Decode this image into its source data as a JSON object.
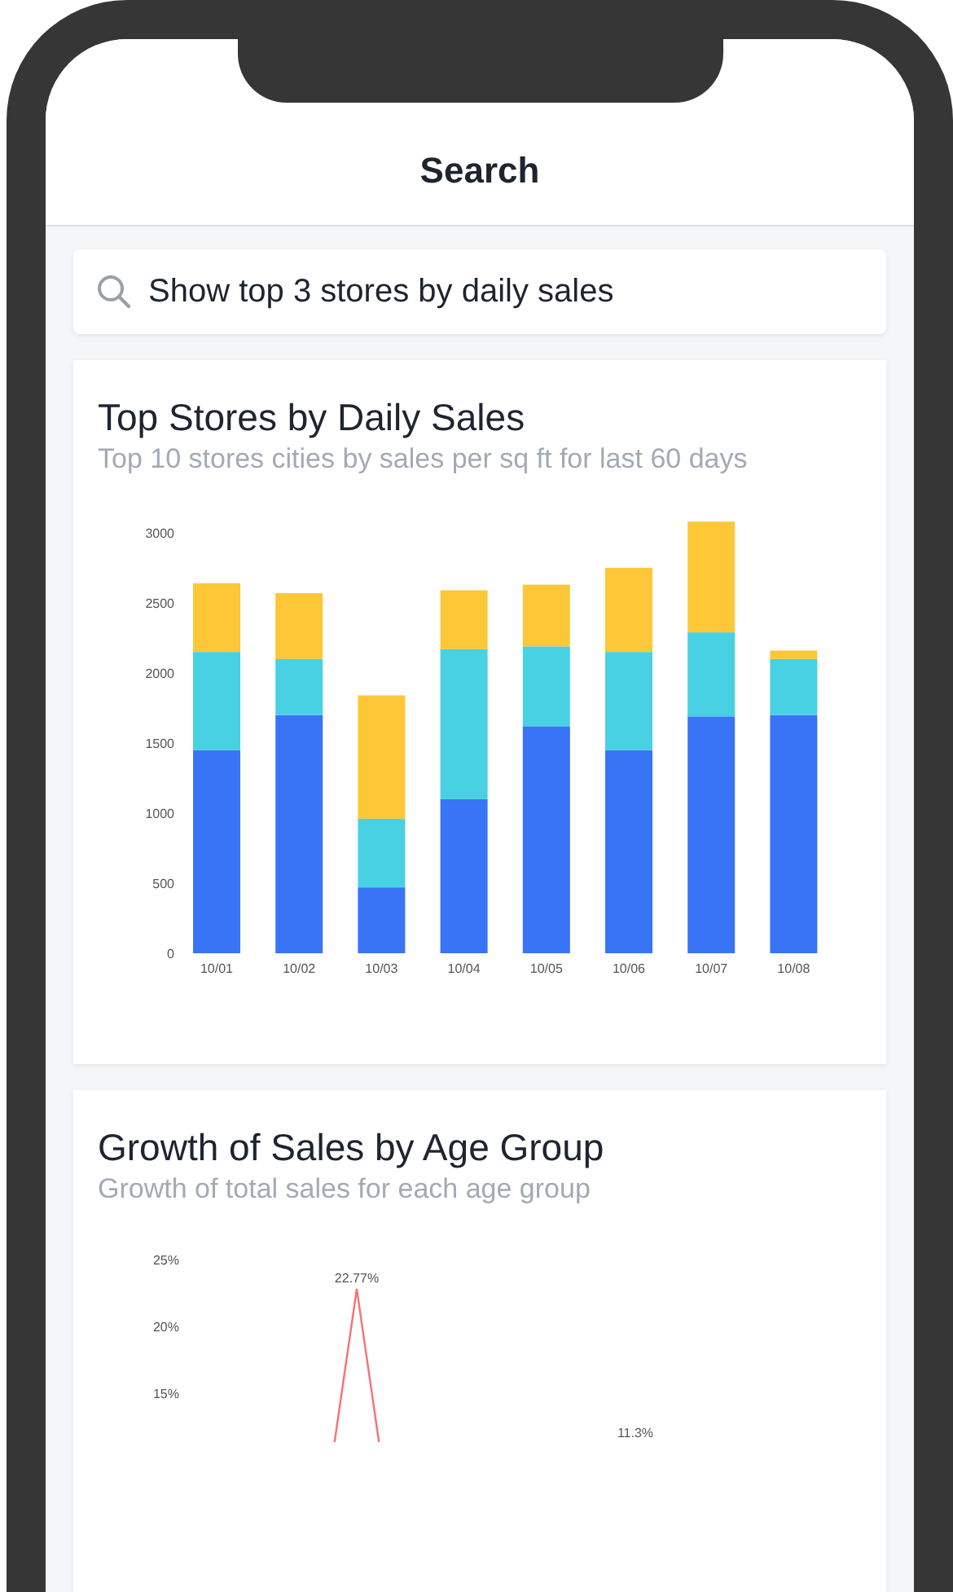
{
  "header": {
    "title": "Search"
  },
  "search": {
    "value": "Show top 3 stores by daily sales"
  },
  "cards": [
    {
      "title": "Top Stores by Daily Sales",
      "subtitle": "Top 10 stores cities by sales per sq ft for last 60 days",
      "chart_data": {
        "type": "bar",
        "stacked": true,
        "categories": [
          "10/01",
          "10/02",
          "10/03",
          "10/04",
          "10/05",
          "10/06",
          "10/07",
          "10/08"
        ],
        "yticks": [
          0,
          500,
          1000,
          1500,
          2000,
          2500,
          3000
        ],
        "ylim": [
          0,
          3100
        ],
        "series": [
          {
            "color": "#3874f5",
            "values": [
              1450,
              1700,
              470,
              1100,
              1620,
              1450,
              1690,
              1700
            ]
          },
          {
            "color": "#48d1e2",
            "values": [
              700,
              400,
              490,
              1070,
              570,
              700,
              600,
              400
            ]
          },
          {
            "color": "#fdc737",
            "values": [
              490,
              470,
              880,
              420,
              440,
              600,
              790,
              60
            ]
          }
        ]
      }
    },
    {
      "title": "Growth of Sales by Age Group",
      "subtitle": "Growth of total sales for each age group",
      "chart": {
        "y_axis_labels": [
          "25%",
          "20%",
          "15%"
        ],
        "data_labels": [
          "22.77%",
          "11.3%"
        ]
      }
    }
  ]
}
